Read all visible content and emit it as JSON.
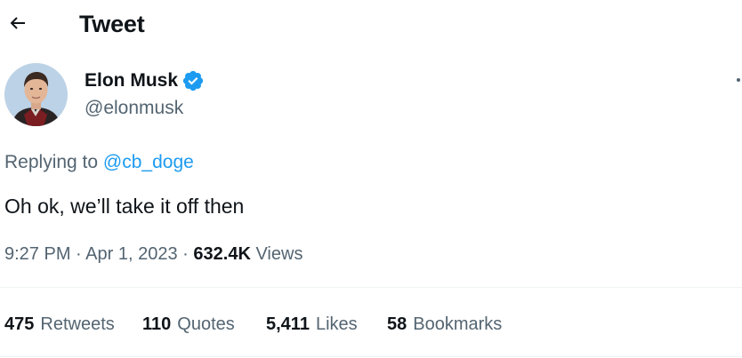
{
  "header": {
    "title": "Tweet",
    "back_icon": "arrow-left-icon"
  },
  "author": {
    "name": "Elon Musk",
    "handle": "@elonmusk",
    "verified_icon": "verified-badge-icon",
    "verified_color": "#1d9bf0"
  },
  "more_icon": "more-options-icon",
  "reply": {
    "prefix": "Replying to",
    "mention": "@cb_doge"
  },
  "tweet": {
    "text": "Oh ok, we’ll take it off then"
  },
  "meta": {
    "time": "9:27 PM",
    "separator": "·",
    "date": "Apr 1, 2023",
    "views_count": "632.4K",
    "views_label": "Views"
  },
  "stats": [
    {
      "count": "475",
      "label": "Retweets"
    },
    {
      "count": "110",
      "label": "Quotes"
    },
    {
      "count": "5,411",
      "label": "Likes"
    },
    {
      "count": "58",
      "label": "Bookmarks"
    }
  ],
  "colors": {
    "text_primary": "#0f1419",
    "text_secondary": "#536471",
    "accent": "#1d9bf0",
    "divider": "#eff3f4"
  }
}
